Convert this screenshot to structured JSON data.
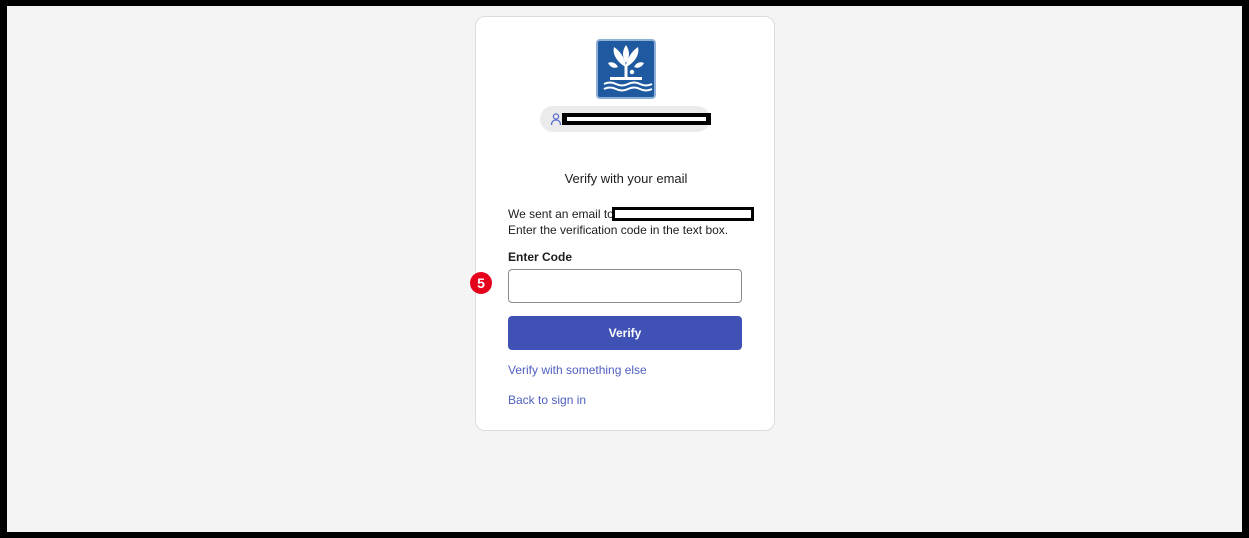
{
  "logo": {
    "icon": "tree-water-logo-icon",
    "color": "#1f5aa0"
  },
  "identifier": {
    "icon": "user-icon"
  },
  "title": "Verify with your email",
  "description": {
    "line1": "We sent an email to",
    "line2": "Enter the verification code in the text box."
  },
  "code": {
    "label": "Enter Code",
    "value": "",
    "placeholder": ""
  },
  "annotation": {
    "step": "5",
    "color": "#e5001c"
  },
  "verify_button": {
    "label": "Verify",
    "color": "#3f51b5"
  },
  "links": {
    "alternate": "Verify with something else",
    "back": "Back to sign in"
  }
}
